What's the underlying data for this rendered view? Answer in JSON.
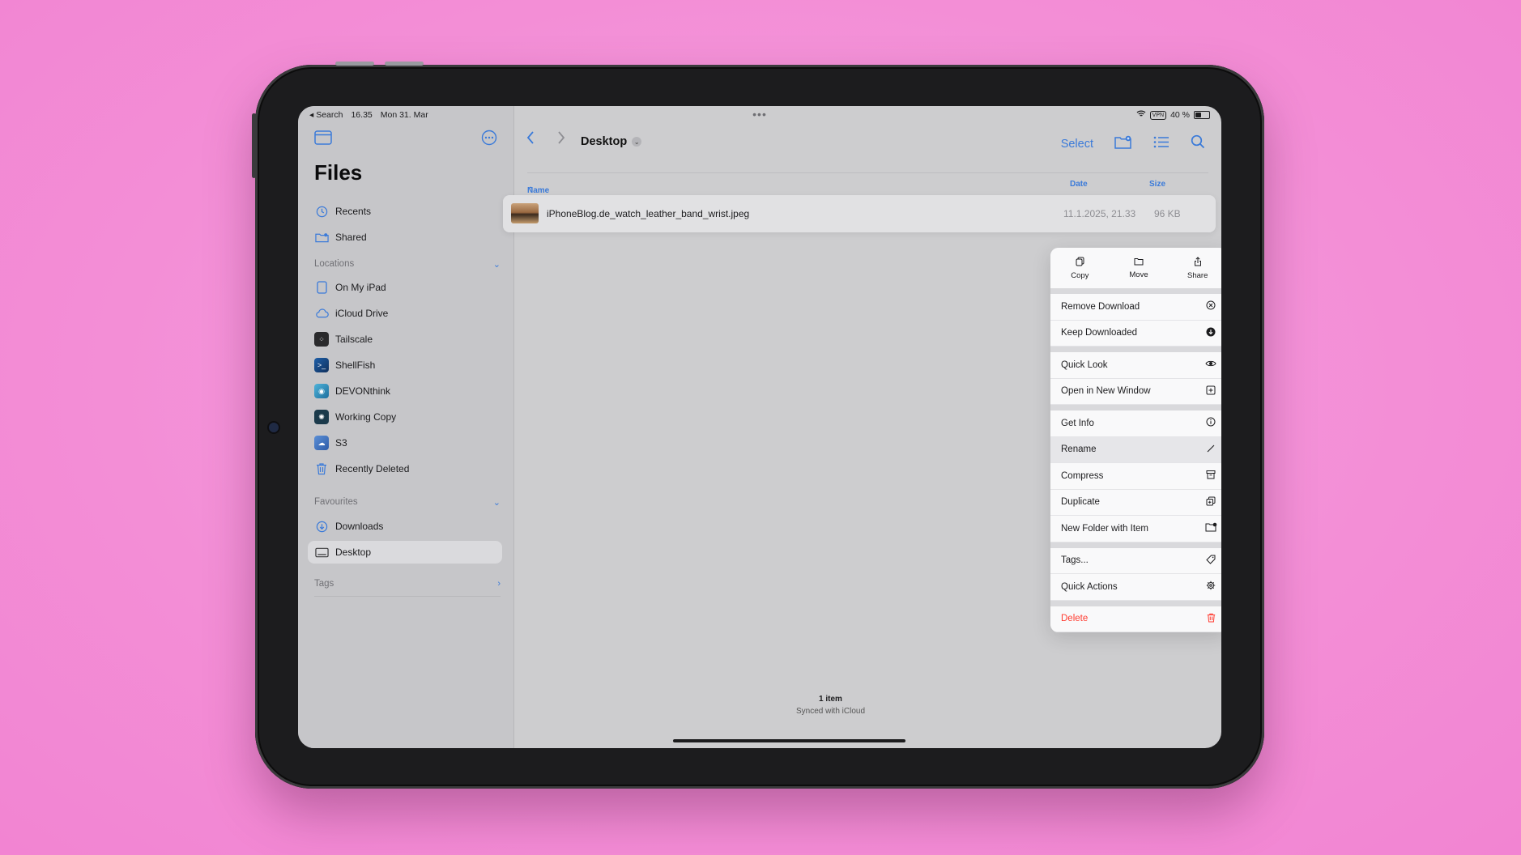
{
  "status": {
    "back_label": "◂ Search",
    "time": "16.35",
    "date": "Mon 31. Mar",
    "vpn": "VPN",
    "battery": "40 %"
  },
  "sidebar": {
    "title": "Files",
    "top_items": [
      {
        "label": "Recents",
        "icon": "clock-icon"
      },
      {
        "label": "Shared",
        "icon": "shared-folder-icon"
      }
    ],
    "locations_label": "Locations",
    "locations": [
      {
        "label": "On My iPad",
        "icon": "ipad-icon"
      },
      {
        "label": "iCloud Drive",
        "icon": "cloud-icon"
      },
      {
        "label": "Tailscale",
        "icon": "tailscale-icon"
      },
      {
        "label": "ShellFish",
        "icon": "shellfish-icon"
      },
      {
        "label": "DEVONthink",
        "icon": "devonthink-icon"
      },
      {
        "label": "Working Copy",
        "icon": "working-copy-icon"
      },
      {
        "label": "S3",
        "icon": "s3-icon"
      },
      {
        "label": "Recently Deleted",
        "icon": "trash-icon"
      }
    ],
    "favourites_label": "Favourites",
    "favourites": [
      {
        "label": "Downloads",
        "icon": "download-icon"
      },
      {
        "label": "Desktop",
        "icon": "desktop-icon",
        "selected": true
      }
    ],
    "tags_label": "Tags"
  },
  "toolbar": {
    "location": "Desktop",
    "select_label": "Select"
  },
  "columns": {
    "name": "Name",
    "date": "Date",
    "size": "Size"
  },
  "file": {
    "name": "iPhoneBlog.de_watch_leather_band_wrist.jpeg",
    "date": "11.1.2025, 21.33",
    "size": "96 KB"
  },
  "menu": {
    "top_actions": [
      {
        "label": "Copy",
        "icon": "copy-icon"
      },
      {
        "label": "Move",
        "icon": "folder-icon"
      },
      {
        "label": "Share",
        "icon": "share-icon"
      }
    ],
    "groups": [
      [
        {
          "label": "Remove Download",
          "icon": "x-circle-icon"
        },
        {
          "label": "Keep Downloaded",
          "icon": "download-filled-icon"
        }
      ],
      [
        {
          "label": "Quick Look",
          "icon": "eye-icon"
        },
        {
          "label": "Open in New Window",
          "icon": "new-window-icon"
        }
      ],
      [
        {
          "label": "Get Info",
          "icon": "info-icon"
        },
        {
          "label": "Rename",
          "icon": "pencil-icon",
          "highlighted": true
        },
        {
          "label": "Compress",
          "icon": "archive-icon"
        },
        {
          "label": "Duplicate",
          "icon": "duplicate-icon"
        },
        {
          "label": "New Folder with Item",
          "icon": "folder-badge-icon"
        }
      ],
      [
        {
          "label": "Tags...",
          "icon": "tag-icon"
        },
        {
          "label": "Quick Actions",
          "icon": "gear-icon",
          "submenu": true
        }
      ],
      [
        {
          "label": "Delete",
          "icon": "trash-icon",
          "destructive": true
        }
      ]
    ]
  },
  "footer": {
    "count": "1 item",
    "sync": "Synced with iCloud"
  },
  "colors": {
    "accent": "#3a7ad9",
    "destructive": "#ff3b30",
    "background": "#f38ed6"
  }
}
